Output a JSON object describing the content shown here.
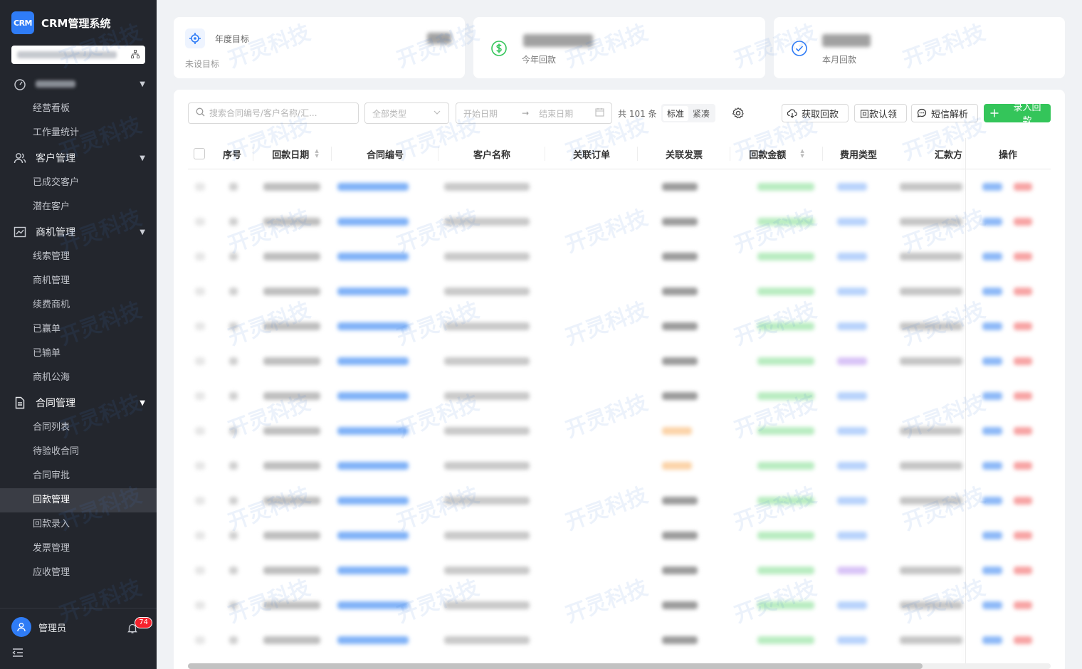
{
  "app": {
    "logo_text": "CRM",
    "title": "CRM管理系统"
  },
  "sidebar": {
    "groups": [
      {
        "label": "",
        "items": [
          "经营看板",
          "工作量统计"
        ]
      },
      {
        "label": "客户管理",
        "items": [
          "已成交客户",
          "潜在客户"
        ]
      },
      {
        "label": "商机管理",
        "items": [
          "线索管理",
          "商机管理",
          "续费商机",
          "已赢单",
          "已输单",
          "商机公海"
        ]
      },
      {
        "label": "合同管理",
        "items": [
          "合同列表",
          "待验收合同",
          "合同审批",
          "回款管理",
          "回款录入",
          "发票管理",
          "应收管理"
        ]
      }
    ],
    "active_item": "回款管理",
    "user": {
      "name": "管理员",
      "notifications": "74"
    }
  },
  "stats": {
    "target": {
      "label": "年度目标",
      "sub": "未设目标"
    },
    "year_payment": {
      "label": "今年回款"
    },
    "month_payment": {
      "label": "本月回款"
    }
  },
  "toolbar": {
    "search_placeholder": "搜索合同编号/客户名称/汇...",
    "type_select": "全部类型",
    "date_start": "开始日期",
    "date_end": "结束日期",
    "total": "共 101 条",
    "density_standard": "标准",
    "density_compact": "紧凑",
    "fetch": "获取回款",
    "claim": "回款认领",
    "sms": "短信解析",
    "add": "录入回款"
  },
  "table": {
    "columns": [
      "序号",
      "回款日期",
      "合同编号",
      "客户名称",
      "关联订单",
      "关联发票",
      "回款金额",
      "费用类型",
      "汇款方",
      "操作"
    ]
  },
  "watermark": "开灵科技",
  "colors": {
    "sidebar": "#23262d",
    "primary": "#2f7cf6",
    "success": "#34c55a",
    "danger": "#f5222d"
  }
}
